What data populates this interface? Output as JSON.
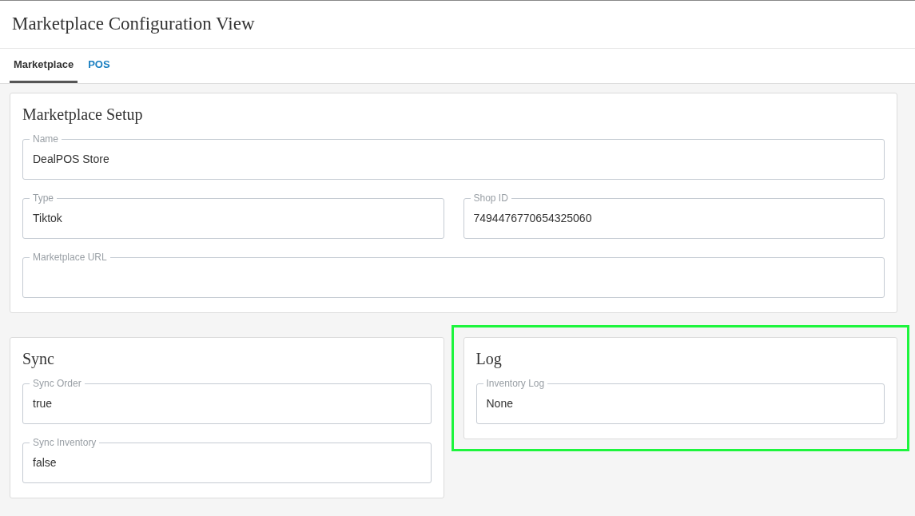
{
  "page": {
    "title": "Marketplace Configuration View"
  },
  "tabs": [
    {
      "label": "Marketplace",
      "selected": true
    },
    {
      "label": "POS",
      "selected": false
    }
  ],
  "setup": {
    "title": "Marketplace Setup",
    "rows": [
      [
        {
          "label": "Name",
          "value": "DealPOS Store"
        }
      ],
      [
        {
          "label": "Type",
          "value": "Tiktok"
        },
        {
          "label": "Shop ID",
          "value": "7494476770654325060"
        }
      ],
      [
        {
          "label": "Marketplace URL"
        }
      ]
    ]
  },
  "sync": {
    "title": "Sync",
    "highlighted": false,
    "fields": [
      {
        "label": "Sync Order",
        "value": "true"
      },
      {
        "label": "Sync Inventory",
        "value": "false"
      }
    ]
  },
  "log": {
    "title": "Log",
    "highlighted": true,
    "fields": [
      {
        "label": "Inventory Log",
        "value": "None"
      }
    ]
  }
}
